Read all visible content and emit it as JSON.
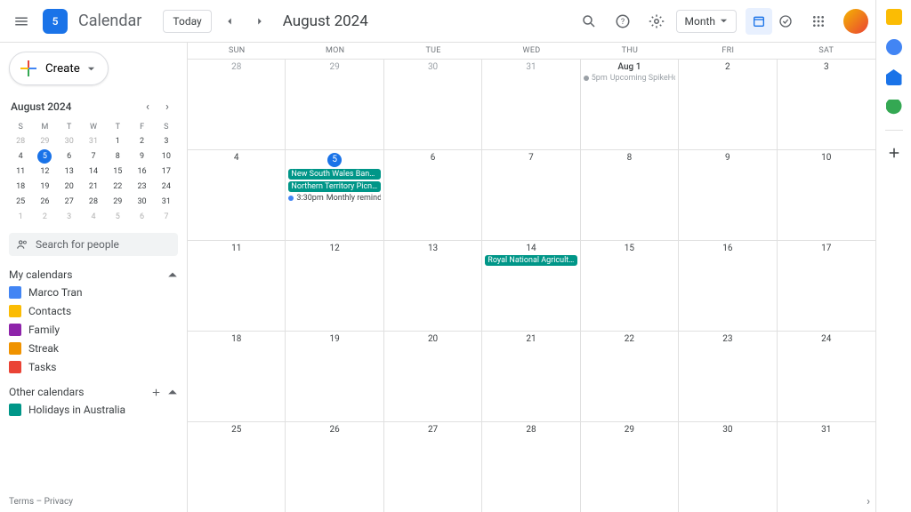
{
  "header": {
    "app_name": "Calendar",
    "logo_day": "5",
    "today": "Today",
    "title": "August 2024",
    "view": "Month"
  },
  "sidebar": {
    "create": "Create",
    "mini_title": "August 2024",
    "day_names": [
      "S",
      "M",
      "T",
      "W",
      "T",
      "F",
      "S"
    ],
    "mini_days": [
      {
        "n": "28",
        "f": 1
      },
      {
        "n": "29",
        "f": 1
      },
      {
        "n": "30",
        "f": 1
      },
      {
        "n": "31",
        "f": 1
      },
      {
        "n": "1"
      },
      {
        "n": "2"
      },
      {
        "n": "3"
      },
      {
        "n": "4"
      },
      {
        "n": "5",
        "t": 1
      },
      {
        "n": "6"
      },
      {
        "n": "7"
      },
      {
        "n": "8"
      },
      {
        "n": "9"
      },
      {
        "n": "10"
      },
      {
        "n": "11"
      },
      {
        "n": "12"
      },
      {
        "n": "13"
      },
      {
        "n": "14"
      },
      {
        "n": "15"
      },
      {
        "n": "16"
      },
      {
        "n": "17"
      },
      {
        "n": "18"
      },
      {
        "n": "19"
      },
      {
        "n": "20"
      },
      {
        "n": "21"
      },
      {
        "n": "22"
      },
      {
        "n": "23"
      },
      {
        "n": "24"
      },
      {
        "n": "25"
      },
      {
        "n": "26"
      },
      {
        "n": "27"
      },
      {
        "n": "28"
      },
      {
        "n": "29"
      },
      {
        "n": "30"
      },
      {
        "n": "31"
      },
      {
        "n": "1",
        "f": 1
      },
      {
        "n": "2",
        "f": 1
      },
      {
        "n": "3",
        "f": 1
      },
      {
        "n": "4",
        "f": 1
      },
      {
        "n": "5",
        "f": 1
      },
      {
        "n": "6",
        "f": 1
      },
      {
        "n": "7",
        "f": 1
      }
    ],
    "search_placeholder": "Search for people",
    "my_cal_title": "My calendars",
    "my_cals": [
      {
        "label": "Marco Tran",
        "color": "#4285f4"
      },
      {
        "label": "Contacts",
        "color": "#fbbc04"
      },
      {
        "label": "Family",
        "color": "#8e24aa"
      },
      {
        "label": "Streak",
        "color": "#f09300"
      },
      {
        "label": "Tasks",
        "color": "#ea4335"
      }
    ],
    "other_cal_title": "Other calendars",
    "other_cals": [
      {
        "label": "Holidays in Australia",
        "color": "#009688"
      }
    ],
    "terms": "Terms",
    "privacy": "Privacy"
  },
  "grid": {
    "dow": [
      "SUN",
      "MON",
      "TUE",
      "WED",
      "THU",
      "FRI",
      "SAT"
    ],
    "weeks": [
      [
        {
          "num": "28",
          "fade": 1
        },
        {
          "num": "29",
          "fade": 1
        },
        {
          "num": "30",
          "fade": 1
        },
        {
          "num": "31",
          "fade": 1
        },
        {
          "num": "Aug 1",
          "bold": 1,
          "events": [
            {
              "type": "line",
              "dot": "#9aa0a6",
              "time": "5pm",
              "title": "Upcoming SpikeHour",
              "fade": 1
            }
          ]
        },
        {
          "num": "2"
        },
        {
          "num": "3"
        }
      ],
      [
        {
          "num": "4"
        },
        {
          "num": "5",
          "today": 1,
          "events": [
            {
              "type": "chip",
              "title": "New South Wales Bank Holiday (New"
            },
            {
              "type": "chip",
              "title": "Northern Territory Picnic Day (Northe"
            },
            {
              "type": "line",
              "dot": "#4285f4",
              "time": "3:30pm",
              "title": "Monthly reminder"
            }
          ]
        },
        {
          "num": "6"
        },
        {
          "num": "7"
        },
        {
          "num": "8"
        },
        {
          "num": "9"
        },
        {
          "num": "10"
        }
      ],
      [
        {
          "num": "11"
        },
        {
          "num": "12"
        },
        {
          "num": "13"
        },
        {
          "num": "14",
          "events": [
            {
              "type": "chip",
              "title": "Royal National Agricultural Show Day"
            }
          ]
        },
        {
          "num": "15"
        },
        {
          "num": "16"
        },
        {
          "num": "17"
        }
      ],
      [
        {
          "num": "18"
        },
        {
          "num": "19"
        },
        {
          "num": "20"
        },
        {
          "num": "21"
        },
        {
          "num": "22"
        },
        {
          "num": "23"
        },
        {
          "num": "24"
        }
      ],
      [
        {
          "num": "25"
        },
        {
          "num": "26"
        },
        {
          "num": "27"
        },
        {
          "num": "28"
        },
        {
          "num": "29"
        },
        {
          "num": "30"
        },
        {
          "num": "31"
        }
      ]
    ]
  },
  "rail_colors": [
    "#fbbc04",
    "#4285f4",
    "#1a73e8",
    "#34a853"
  ]
}
